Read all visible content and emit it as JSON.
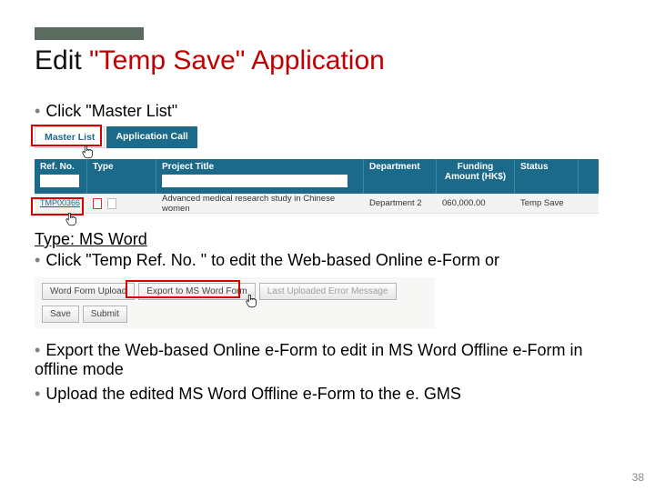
{
  "title": {
    "part1": "Edit ",
    "red": "\"Temp Save\" Application"
  },
  "bullets": {
    "b1": "Click \"Master List\"",
    "typehead": "Type: MS Word",
    "b2": "Click \"Temp Ref. No. \" to edit the Web-based Online e-Form or",
    "b3": "Export the Web-based Online e-Form to edit in MS Word Offline e-Form in offline mode",
    "b4": "Upload the edited MS Word Offline e-Form to the e. GMS"
  },
  "shot1": {
    "tabs": {
      "master": "Master List",
      "appcall": "Application Call"
    },
    "headers": {
      "ref": "Ref. No.",
      "type": "Type",
      "title": "Project Title",
      "dept": "Department",
      "fund": "Funding Amount (HK$)",
      "status": "Status"
    },
    "row": {
      "ref": "TMP00366",
      "title": "Advanced medical research study in Chinese women",
      "dept": "Department 2",
      "fund": "060,000.00",
      "status": "Temp Save"
    }
  },
  "shot2": {
    "buttons": {
      "upload": "Word Form Upload",
      "export": "Export to MS Word Form",
      "lasterr": "Last Uploaded Error Message",
      "save": "Save",
      "submit": "Submit"
    }
  },
  "page_number": "38"
}
